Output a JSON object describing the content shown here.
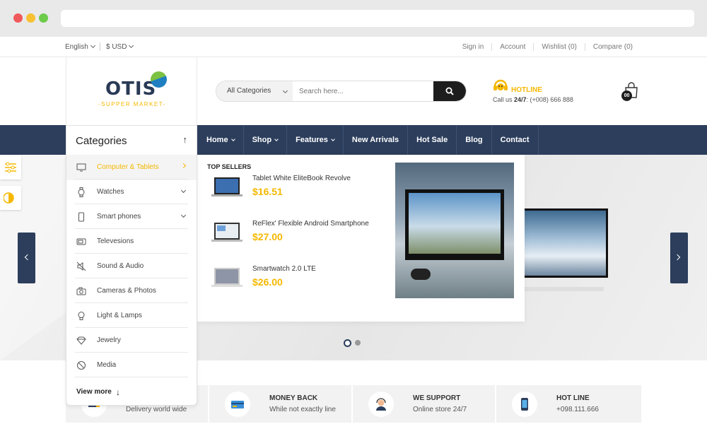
{
  "topbar": {
    "language": "English",
    "currency": "$ USD",
    "links": [
      "Sign in",
      "Account",
      "Wishlist  (0)",
      "Compare  (0)"
    ]
  },
  "header": {
    "logo_text": "OTIS",
    "logo_sub": "-SUPPER MARKET-",
    "search_category": "All Categories",
    "search_placeholder": "Search here...",
    "hotline_title": "HOTLINE",
    "hotline_prefix": "Call us ",
    "hotline_hours": "24/7",
    "hotline_number": ": (+008) 666 888",
    "cart_count": "00"
  },
  "nav": {
    "categories_title": "Categories",
    "items": [
      "Home",
      "Shop",
      "Features",
      "New Arrivals",
      "Hot Sale",
      "Blog",
      "Contact"
    ]
  },
  "categories": [
    {
      "label": "Computer & Tablets",
      "icon": "monitor-icon"
    },
    {
      "label": "Watches",
      "icon": "watch-icon"
    },
    {
      "label": "Smart phones",
      "icon": "phone-icon"
    },
    {
      "label": "Televesions",
      "icon": "tv-icon"
    },
    {
      "label": "Sound & Audio",
      "icon": "speaker-icon"
    },
    {
      "label": "Cameras & Photos",
      "icon": "camera-icon"
    },
    {
      "label": "Light & Lamps",
      "icon": "bulb-icon"
    },
    {
      "label": "Jewelry",
      "icon": "diamond-icon"
    },
    {
      "label": "Media",
      "icon": "media-icon"
    }
  ],
  "view_more": "View more",
  "mega": {
    "heading": "TOP SELLERS",
    "products": [
      {
        "name": "Tablet White EliteBook Revolve",
        "price": "$16.51"
      },
      {
        "name": "ReFlex' Flexible Android Smartphone",
        "price": "$27.00"
      },
      {
        "name": "Smartwatch 2.0 LTE",
        "price": "$26.00"
      }
    ]
  },
  "slider": {
    "slides": 2,
    "active": 1
  },
  "features": [
    {
      "title": "",
      "subtitle": "Delivery world wide",
      "icon": "delivery-icon"
    },
    {
      "title": "MONEY BACK",
      "subtitle": "While not exactly line",
      "icon": "card-icon"
    },
    {
      "title": "WE SUPPORT",
      "subtitle": "Online store 24/7",
      "icon": "support-icon"
    },
    {
      "title": "HOT LINE",
      "subtitle": "+098.111.666",
      "icon": "mobile-icon"
    }
  ],
  "colors": {
    "accent": "#f5b800",
    "nav": "#2c3e5c"
  }
}
